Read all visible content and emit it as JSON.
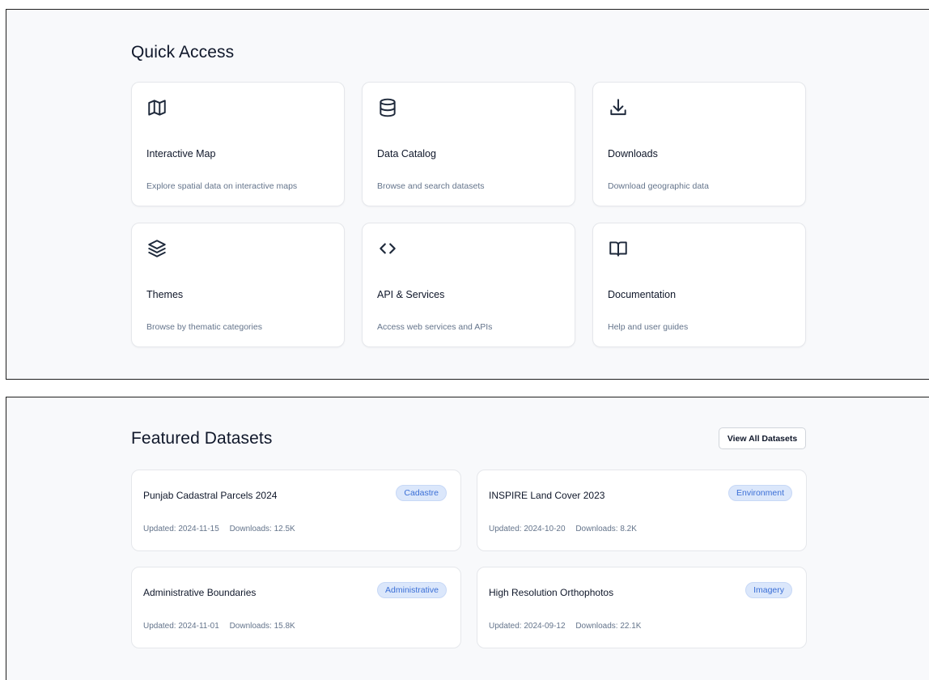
{
  "quick_access": {
    "title": "Quick Access",
    "cards": [
      {
        "icon": "map-icon",
        "title": "Interactive Map",
        "description": "Explore spatial data on interactive maps"
      },
      {
        "icon": "database-icon",
        "title": "Data Catalog",
        "description": "Browse and search datasets"
      },
      {
        "icon": "download-icon",
        "title": "Downloads",
        "description": "Download geographic data"
      },
      {
        "icon": "layers-icon",
        "title": "Themes",
        "description": "Browse by thematic categories"
      },
      {
        "icon": "code-icon",
        "title": "API & Services",
        "description": "Access web services and APIs"
      },
      {
        "icon": "book-open-icon",
        "title": "Documentation",
        "description": "Help and user guides"
      }
    ]
  },
  "featured": {
    "title": "Featured Datasets",
    "view_all_label": "View All Datasets",
    "datasets": [
      {
        "title": "Punjab Cadastral Parcels 2024",
        "badge": "Cadastre",
        "updated": "Updated: 2024-11-15",
        "downloads": "Downloads: 12.5K"
      },
      {
        "title": "INSPIRE Land Cover 2023",
        "badge": "Environment",
        "updated": "Updated: 2024-10-20",
        "downloads": "Downloads: 8.2K"
      },
      {
        "title": "Administrative Boundaries",
        "badge": "Administrative",
        "updated": "Updated: 2024-11-01",
        "downloads": "Downloads: 15.8K"
      },
      {
        "title": "High Resolution Orthophotos",
        "badge": "Imagery",
        "updated": "Updated: 2024-09-12",
        "downloads": "Downloads: 22.1K"
      }
    ]
  },
  "colors": {
    "panel_background": "#f8f9fb",
    "badge_background": "#dbe7fb",
    "badge_text": "#3b6fd6",
    "muted_text": "#64748b"
  }
}
